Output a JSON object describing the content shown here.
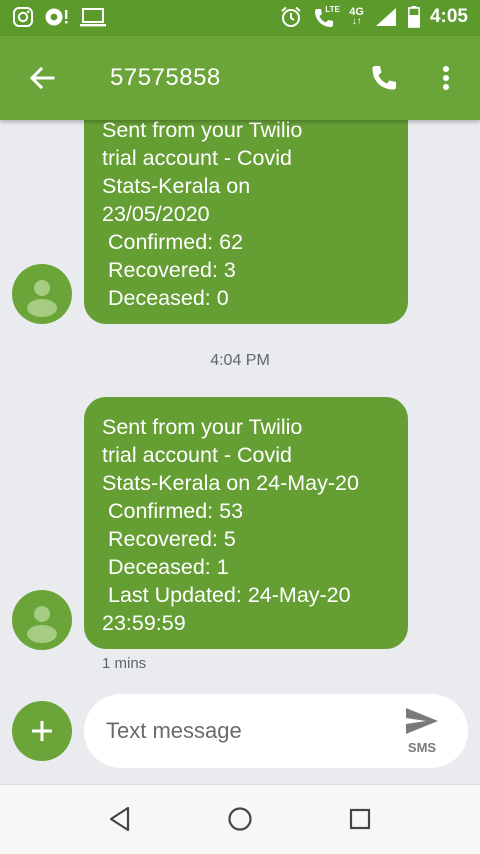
{
  "status_bar": {
    "icons_left": [
      "instagram-icon",
      "notification-icon",
      "cast-icon"
    ],
    "icons_right": [
      "alarm-icon",
      "volte-call-icon",
      "network-icon",
      "signal-icon",
      "battery-icon"
    ],
    "lte_label": "LTE",
    "network_label": "4G",
    "time": "4:05"
  },
  "app_bar": {
    "title": "57575858",
    "back_icon": "arrow-left-icon",
    "call_icon": "phone-icon",
    "more_icon": "more-vert-icon"
  },
  "messages": [
    {
      "text": "Sent from your Twilio\ntrial account - Covid\nStats-Kerala on\n23/05/2020\n Confirmed: 62\n Recovered: 3\n Deceased: 0"
    },
    {
      "text": "Sent from your Twilio\ntrial account - Covid\nStats-Kerala on 24-May-20\n Confirmed: 53\n Recovered: 5\n Deceased: 1\n Last Updated: 24-May-20\n23:59:59",
      "meta": "1 mins"
    }
  ],
  "timestamp_divider": "4:04 PM",
  "composer": {
    "placeholder": "Text message",
    "send_label": "SMS"
  },
  "nav_bar": {
    "icons": [
      "back-triangle-icon",
      "home-circle-icon",
      "recents-square-icon"
    ]
  },
  "colors": {
    "status_bar": "#5d9a2c",
    "app_bar": "#6ba539",
    "bubble": "#659f34",
    "background": "#e9ebef"
  }
}
